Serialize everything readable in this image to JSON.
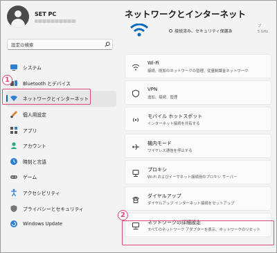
{
  "profile": {
    "name": "SET PC"
  },
  "search": {
    "placeholder": "設定の検索"
  },
  "nav": {
    "items": [
      {
        "label": "システム",
        "icon": "monitor-icon"
      },
      {
        "label": "Bluetooth とデバイス",
        "icon": "bluetooth-devices-icon"
      },
      {
        "label": "ネットワークとインターネット",
        "icon": "network-icon",
        "active": true
      },
      {
        "label": "個人用設定",
        "icon": "paintbrush-icon"
      },
      {
        "label": "アプリ",
        "icon": "apps-icon"
      },
      {
        "label": "アカウント",
        "icon": "account-icon"
      },
      {
        "label": "時刻と言語",
        "icon": "clock-globe-icon"
      },
      {
        "label": "ゲーム",
        "icon": "gamepad-icon"
      },
      {
        "label": "アクセシビリティ",
        "icon": "accessibility-icon"
      },
      {
        "label": "プライバシーとセキュリティ",
        "icon": "shield-icon"
      },
      {
        "label": "Windows Update",
        "icon": "update-icon"
      }
    ]
  },
  "annotations": {
    "badge1": "1",
    "badge2": "2"
  },
  "main": {
    "title": "ネットワークとインターネット",
    "hero_status": "接続済み、セキュリティ保護あ",
    "hero_side_1": "プ",
    "hero_side_2": "5 GHz",
    "cards": [
      {
        "title": "Wi-Fi",
        "subtitle": "接続、既知のネットワークの管理、従量制課金ネットワーク",
        "icon": "wifi-icon"
      },
      {
        "title": "VPN",
        "subtitle": "追加、接続、管理",
        "icon": "vpn-shield-icon"
      },
      {
        "title": "モバイル ホットスポット",
        "subtitle": "インターネット接続を共有する",
        "icon": "hotspot-icon"
      },
      {
        "title": "機内モード",
        "subtitle": "ワイヤレス通信を停止する",
        "icon": "airplane-icon"
      },
      {
        "title": "プロキシ",
        "subtitle": "Wi-Fi およびイーサネット接続用のプロキシ サーバー",
        "icon": "proxy-icon"
      },
      {
        "title": "ダイヤルアップ",
        "subtitle": "ダイヤルアップ インターネット接続をセットアップ",
        "icon": "dialup-icon"
      },
      {
        "title": "ネットワークの詳細設定",
        "subtitle": "すべてのネットワーク アダプターを表示、ネットワークのリセット",
        "icon": "advanced-network-icon"
      }
    ]
  },
  "colors": {
    "accent": "#0067c0",
    "highlight": "#e0457b",
    "background": "#f3f3f3",
    "card": "#fbfbfb"
  }
}
